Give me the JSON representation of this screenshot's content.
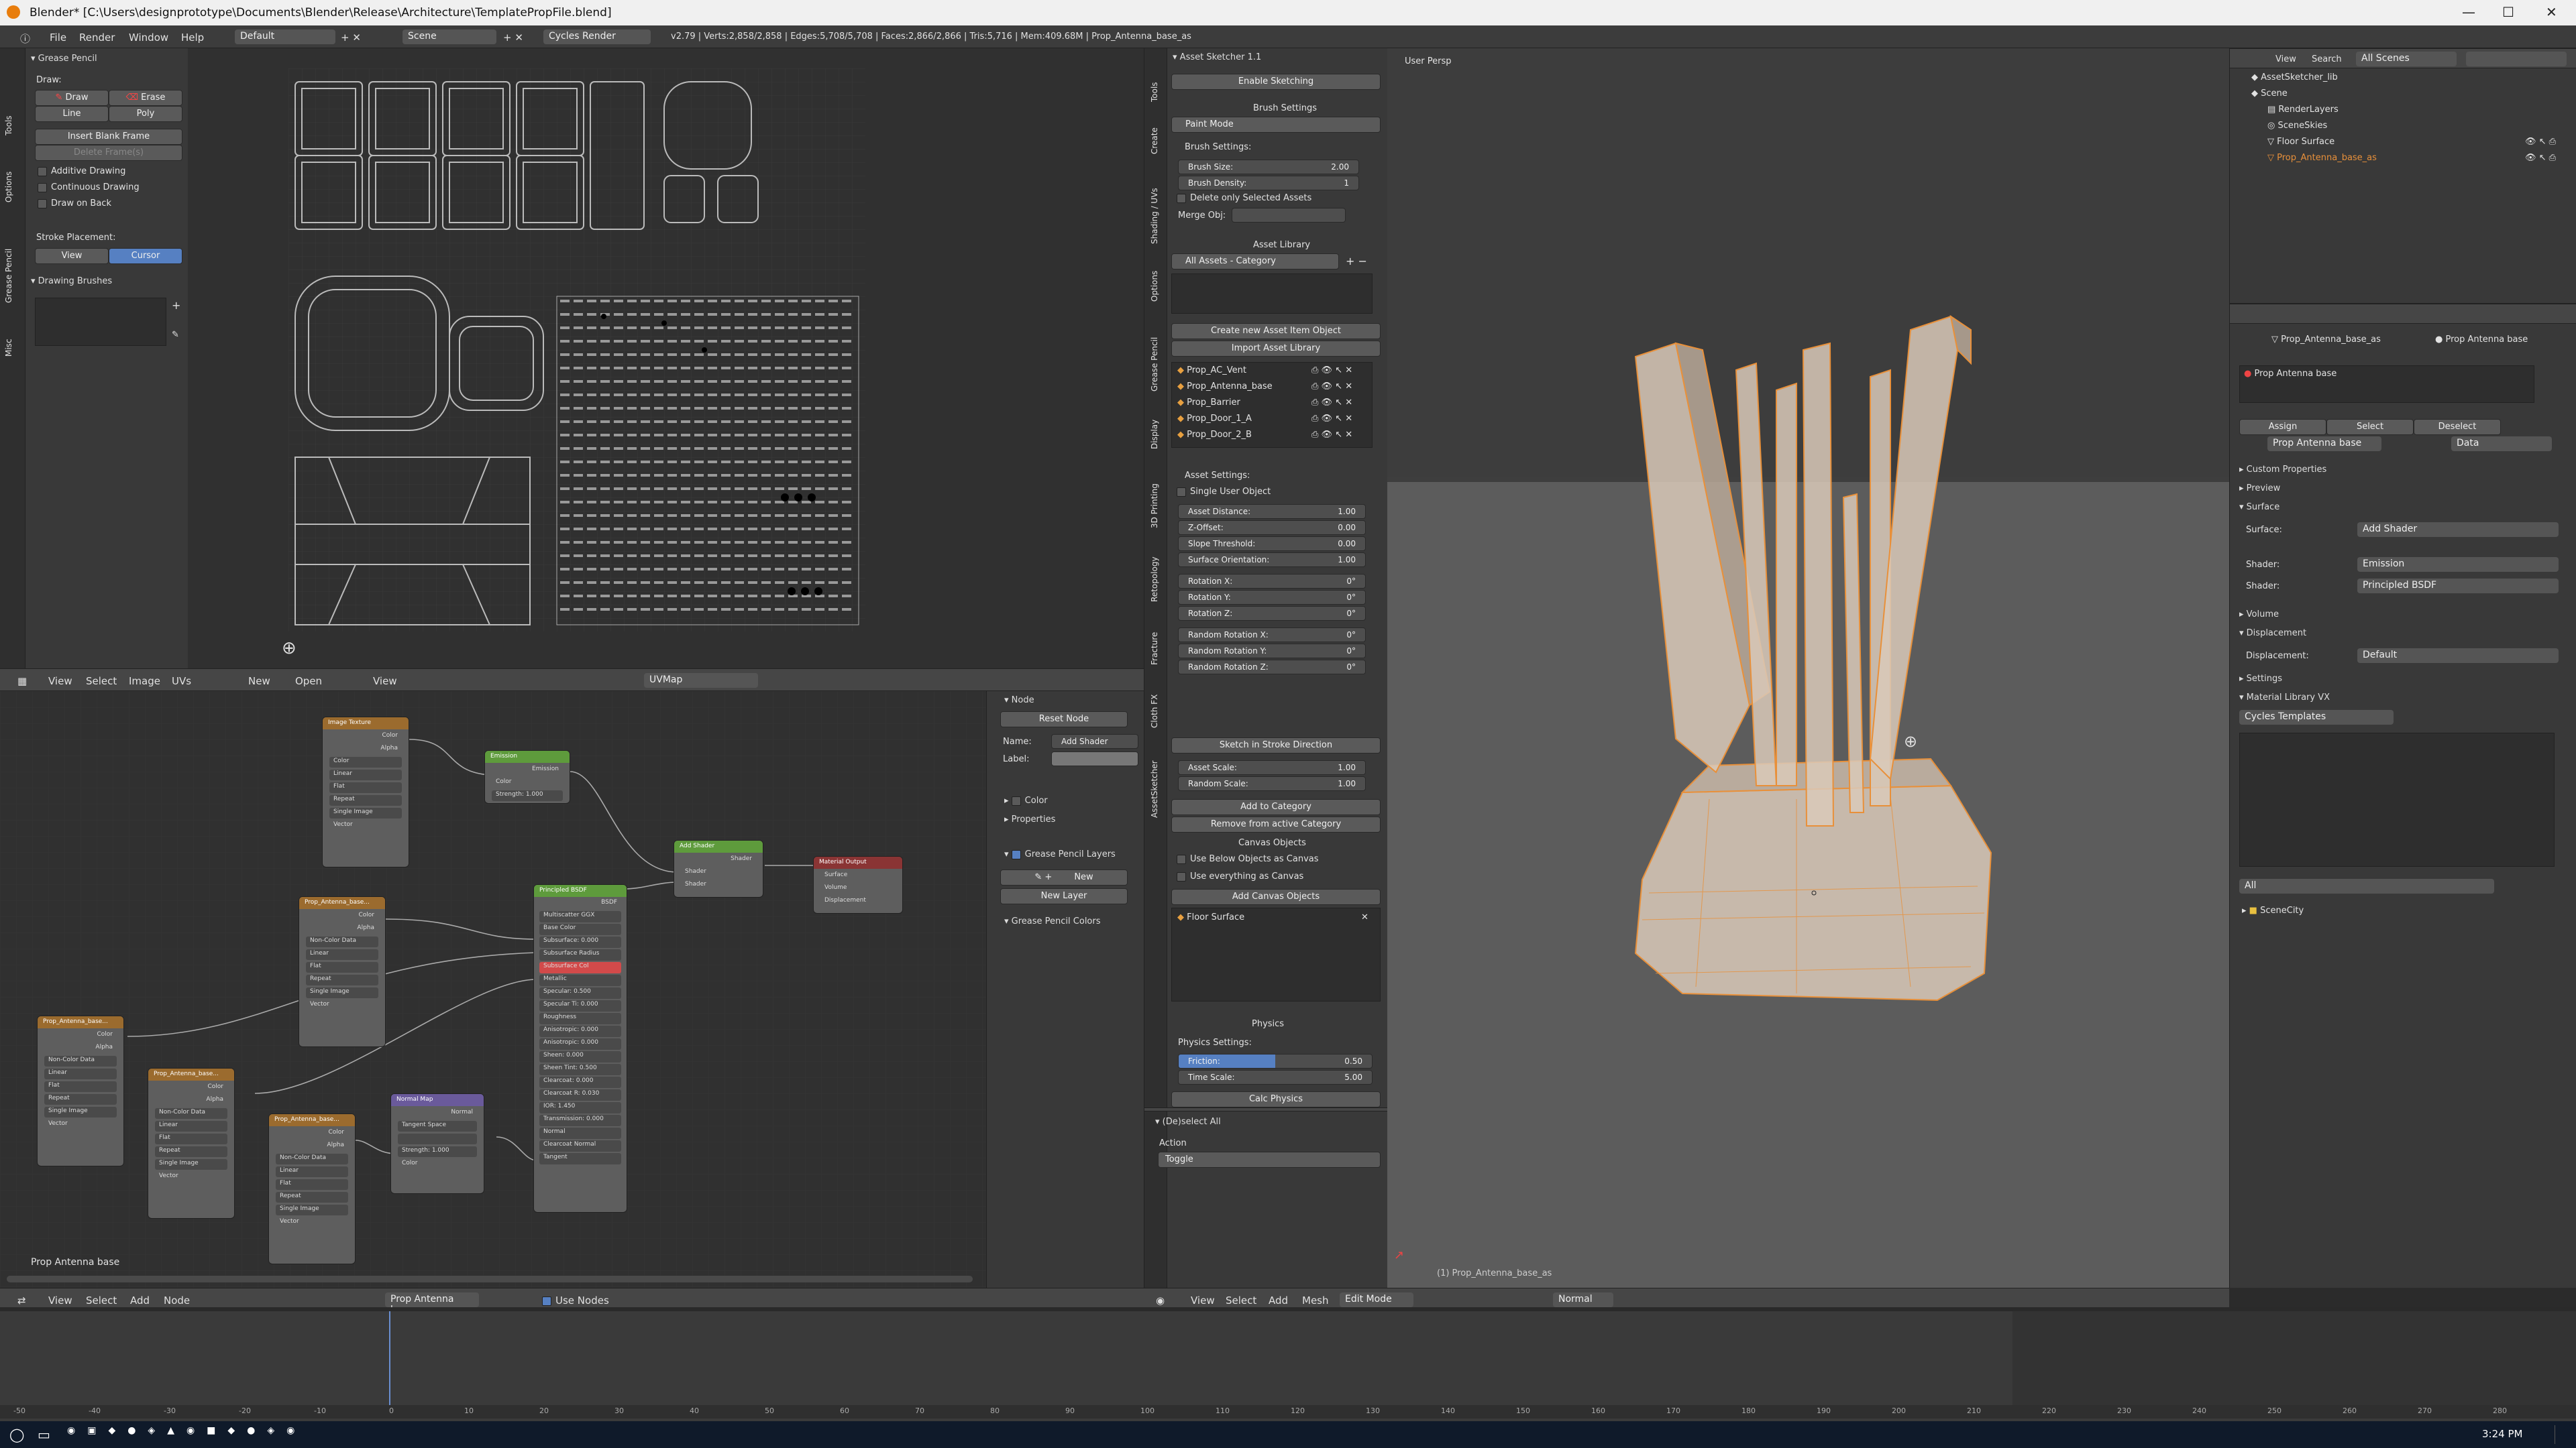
{
  "title_bar": {
    "text": "Blender* [C:\\Users\\designprototype\\Documents\\Blender\\Release\\Architecture\\TemplatePropFile.blend]"
  },
  "info_header": {
    "menus": [
      "File",
      "Render",
      "Window",
      "Help"
    ],
    "layout": "Default",
    "scene": "Scene",
    "engine": "Cycles Render",
    "stats": "v2.79 | Verts:2,858/2,858 | Edges:5,708/5,708 | Faces:2,866/2,866 | Tris:5,716 | Mem:409.68M | Prop_Antenna_base_as"
  },
  "grease_pencil": {
    "header": "Grease Pencil",
    "draw_label": "Draw:",
    "draw": "Draw",
    "erase": "Erase",
    "line": "Line",
    "poly": "Poly",
    "insert_blank_frame": "Insert Blank Frame",
    "delete_frames": "Delete Frame(s)",
    "additive": "Additive Drawing",
    "continuous": "Continuous Drawing",
    "draw_on_back": "Draw on Back",
    "stroke_placement": "Stroke Placement:",
    "view": "View",
    "cursor": "Cursor",
    "drawing_brushes": "Drawing Brushes",
    "tabs": [
      "Tools",
      "Options",
      "Grease Pencil",
      "Misc"
    ]
  },
  "uv_header": {
    "menus": [
      "View",
      "Select",
      "Image",
      "UVs"
    ],
    "new": "New",
    "open": "Open",
    "view": "View",
    "uvmap": "UVMap"
  },
  "node_panel": {
    "node": "Node",
    "reset_node": "Reset Node",
    "name_label": "Name:",
    "name_value": "Add Shader",
    "label_label": "Label:",
    "color": "Color",
    "properties": "Properties",
    "gp_layers": "Grease Pencil Layers",
    "new": "New",
    "new_layer": "New Layer",
    "gp_colors": "Grease Pencil Colors"
  },
  "node_editor": {
    "material_name": "Prop Antenna base",
    "menus": [
      "View",
      "Select",
      "Add",
      "Node"
    ],
    "mat_field": "Prop Antenna base",
    "use_nodes": "Use Nodes",
    "nodes": {
      "image_texture": {
        "title": "Image Texture",
        "rows": [
          "Color",
          "Alpha",
          "Color",
          "Linear",
          "Flat",
          "Repeat",
          "Single Image",
          "Vector"
        ]
      },
      "emission": {
        "title": "Emission",
        "rows": [
          "Emission",
          "Color",
          "Strength: 1.000"
        ]
      },
      "add_shader": {
        "title": "Add Shader",
        "rows": [
          "Shader",
          "Shader",
          "Shader"
        ]
      },
      "material_output": {
        "title": "Material Output",
        "rows": [
          "Surface",
          "Volume",
          "Displacement"
        ]
      },
      "principled": {
        "title": "Principled BSDF",
        "rows": [
          "BSDF",
          "Multiscatter GGX",
          "Base Color",
          "Subsurface: 0.000",
          "Subsurface Radius",
          "Subsurface Col",
          "Metallic",
          "Specular: 0.500",
          "Specular Ti: 0.000",
          "Roughness",
          "Anisotropic: 0.000",
          "Anisotropic: 0.000",
          "Sheen: 0.000",
          "Sheen Tint: 0.500",
          "Clearcoat: 0.000",
          "Clearcoat R: 0.030",
          "IOR: 1.450",
          "Transmission: 0.000",
          "Normal",
          "Clearcoat Normal",
          "Tangent"
        ]
      },
      "tex_a": {
        "title": "Prop_Antenna_base...",
        "rows": [
          "Color",
          "Alpha",
          "Non-Color Data",
          "Linear",
          "Flat",
          "Repeat",
          "Single Image",
          "Vector"
        ]
      },
      "tex_b": {
        "title": "Prop_Antenna_base...",
        "rows": [
          "Color",
          "Alpha",
          "Non-Color Data",
          "Linear",
          "Flat",
          "Repeat",
          "Single Image",
          "Vector"
        ]
      },
      "tex_c": {
        "title": "Prop_Antenna_base...",
        "rows": [
          "Color",
          "Alpha",
          "Non-Color Data",
          "Linear",
          "Flat",
          "Repeat",
          "Single Image",
          "Vector"
        ]
      },
      "tex_d": {
        "title": "Prop_Antenna_base...",
        "rows": [
          "Color",
          "Alpha",
          "Non-Color Data",
          "Linear",
          "Flat",
          "Repeat",
          "Single Image",
          "Vector"
        ]
      },
      "normal_map": {
        "title": "Normal Map",
        "rows": [
          "Normal",
          "Tangent Space",
          "",
          "Strength: 1.000",
          "Color"
        ]
      }
    }
  },
  "asset_sketcher": {
    "header": "Asset Sketcher 1.1",
    "enable": "Enable Sketching",
    "brush_settings": "Brush Settings",
    "paint_mode": "Paint Mode",
    "brush_settings_label": "Brush Settings:",
    "brush_size_label": "Brush Size:",
    "brush_size": "2.00",
    "brush_density_label": "Brush Density:",
    "brush_density": "1",
    "delete_only_selected": "Delete only Selected Assets",
    "merge_obj": "Merge Obj:",
    "asset_library": "Asset Library",
    "all_assets": "All Assets - Category",
    "create_new": "Create new Asset Item Object",
    "import": "Import Asset Library",
    "assets": [
      "Prop_AC_Vent",
      "Prop_Antenna_base",
      "Prop_Barrier",
      "Prop_Door_1_A",
      "Prop_Door_2_B"
    ],
    "asset_settings": "Asset Settings:",
    "single_user": "Single User Object",
    "asset_distance_label": "Asset Distance:",
    "asset_distance": "1.00",
    "z_offset_label": "Z-Offset:",
    "z_offset": "0.00",
    "slope_label": "Slope Threshold:",
    "slope": "0.00",
    "surface_orient_label": "Surface Orientation:",
    "surface_orient": "1.00",
    "rot_x_label": "Rotation X:",
    "rot_x": "0°",
    "rot_y_label": "Rotation Y:",
    "rot_y": "0°",
    "rot_z_label": "Rotation Z:",
    "rot_z": "0°",
    "rrot_x_label": "Random Rotation X:",
    "rrot_x": "0°",
    "rrot_y_label": "Random Rotation Y:",
    "rrot_y": "0°",
    "rrot_z_label": "Random Rotation Z:",
    "rrot_z": "0°",
    "sketch_stroke": "Sketch in Stroke Direction",
    "asset_scale_label": "Asset Scale:",
    "asset_scale": "1.00",
    "random_scale_label": "Random Scale:",
    "random_scale": "1.00",
    "add_category": "Add to Category",
    "remove_category": "Remove from active Category",
    "canvas_objects": "Canvas Objects",
    "use_below": "Use Below Objects as Canvas",
    "use_everything": "Use everything as Canvas",
    "add_canvas": "Add Canvas Objects",
    "floor_surface": "Floor Surface",
    "physics": "Physics",
    "physics_settings": "Physics Settings:",
    "friction_label": "Friction:",
    "friction": "0.50",
    "time_scale_label": "Time Scale:",
    "time_scale": "5.00",
    "calc_physics": "Calc Physics",
    "deselect_all": "(De)select All",
    "action_label": "Action",
    "action_value": "Toggle",
    "tabs": [
      "Tools",
      "Create",
      "Shading / UVs",
      "Options",
      "Grease Pencil",
      "Display",
      "3D Printing",
      "Retopology",
      "Fracture",
      "Cloth FX",
      "AssetSketcher"
    ]
  },
  "viewport": {
    "label": "User Persp",
    "object_label": "(1) Prop_Antenna_base_as",
    "menus": [
      "View",
      "Select",
      "Add",
      "Mesh"
    ],
    "mode": "Edit Mode",
    "pivot": "Normal"
  },
  "outliner": {
    "menus": [
      "View",
      "Search"
    ],
    "scenes": "All Scenes",
    "items": [
      "AssetSketcher_lib",
      "Scene",
      "RenderLayers",
      "SceneSkies",
      "Floor Surface",
      "Prop_Antenna_base_as"
    ]
  },
  "properties": {
    "breadcrumb_obj": "Prop_Antenna_base_as",
    "breadcrumb_mat": "Prop Antenna base",
    "slot": "Prop Antenna base",
    "assign": "Assign",
    "select": "Select",
    "deselect": "Deselect",
    "mat_field": "Prop Antenna base",
    "data": "Data",
    "custom_properties": "Custom Properties",
    "preview": "Preview",
    "surface": "Surface",
    "surface_label": "Surface:",
    "surface_value": "Add Shader",
    "shader1_label": "Shader:",
    "shader1_value": "Emission",
    "shader2_label": "Shader:",
    "shader2_value": "Principled BSDF",
    "volume": "Volume",
    "displacement": "Displacement",
    "displacement_label": "Displacement:",
    "displacement_value": "Default",
    "settings": "Settings",
    "material_library": "Material Library VX",
    "cycles_templates": "Cycles Templates",
    "all": "All",
    "scene_city": "SceneCity"
  },
  "timeline": {
    "ticks": [
      "-50",
      "-40",
      "-30",
      "-20",
      "-10",
      "0",
      "10",
      "20",
      "30",
      "40",
      "50",
      "60",
      "70",
      "80",
      "90",
      "100",
      "110",
      "120",
      "130",
      "140",
      "150",
      "160",
      "170",
      "180",
      "190",
      "200",
      "210",
      "220",
      "230",
      "240",
      "250",
      "260",
      "270",
      "280"
    ]
  },
  "taskbar": {
    "time": "3:24 PM"
  }
}
